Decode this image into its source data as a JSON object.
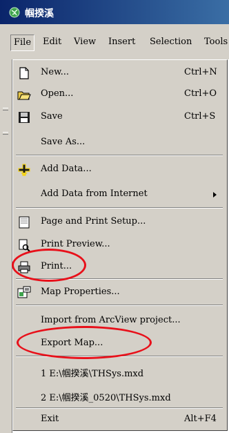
{
  "window": {
    "title": "帼揆溪"
  },
  "menubar": {
    "items": [
      "File",
      "Edit",
      "View",
      "Insert",
      "Selection",
      "Tools"
    ]
  },
  "menu": {
    "new": {
      "label": "New...",
      "shortcut": "Ctrl+N"
    },
    "open": {
      "label": "Open...",
      "shortcut": "Ctrl+O"
    },
    "save": {
      "label": "Save",
      "shortcut": "Ctrl+S"
    },
    "save_as": {
      "label": "Save As..."
    },
    "add_data": {
      "label": "Add Data..."
    },
    "add_data_internet": {
      "label": "Add Data from Internet"
    },
    "page_setup": {
      "label": "Page and Print Setup..."
    },
    "print_preview": {
      "label": "Print Preview..."
    },
    "print": {
      "label": "Print..."
    },
    "map_properties": {
      "label": "Map Properties..."
    },
    "import_arcview": {
      "label": "Import from ArcView project..."
    },
    "export_map": {
      "label": "Export Map..."
    },
    "recent_1": {
      "label": "1 E:\\帼揆溪\\THSys.mxd"
    },
    "recent_2": {
      "label": "2 E:\\帼揆溪_0520\\THSys.mxd"
    },
    "exit": {
      "label": "Exit",
      "shortcut": "Alt+F4"
    }
  },
  "colors": {
    "menu_bg": "#d4d0c8",
    "title_bg": "#0a246a",
    "annotation": "#e8101a"
  }
}
